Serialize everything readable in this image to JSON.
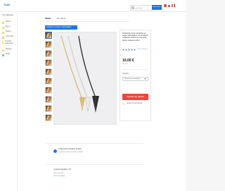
{
  "brand": {
    "logo": "Tudo"
  },
  "search": {
    "placeholder": "Rechercher",
    "button_label": "Rechercher"
  },
  "sidebar": {
    "title": "Top catégories",
    "items": [
      {
        "label": "Beauté"
      },
      {
        "label": "Bijoux"
      },
      {
        "label": "Maison"
      },
      {
        "label": "Santé Bien"
      },
      {
        "label": "Produits saisonniers"
      },
      {
        "label": "Mariage"
      },
      {
        "label": "Mode"
      }
    ]
  },
  "tabs": [
    {
      "label": "Détails"
    },
    {
      "label": "Avis clients"
    }
  ],
  "gallery": {
    "header": "Livraison en France métropolitaine"
  },
  "product": {
    "title": "Pendentif pointe de flèche en argent 925 plaqué, un pendentif tendance unisexe et une belle option cadeau à offrir",
    "rating_text": "4,7/5 · 128 avis",
    "price": "10,00 €",
    "price_sub": "Prix TTC",
    "quantity_label": "Quantité",
    "quantity_value": "Choisissez un montant",
    "add_to_cart": "Ajouter au panier",
    "wishlist": "Ajouter à mes favoris"
  },
  "shipping": {
    "title": "Vérifié par les Artisans de PNG",
    "subtitle": "Un produit vérifié avant d'être expédié"
  },
  "seller": {
    "title": "Livraison standard · 5 €",
    "line": "Envoi sous 48h",
    "link": "Voir les conditions"
  }
}
